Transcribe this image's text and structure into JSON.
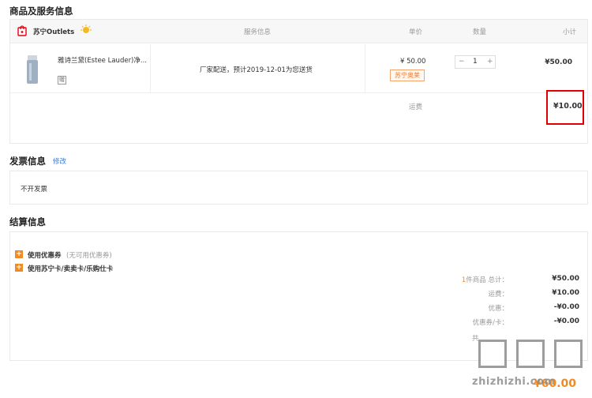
{
  "goods_section": {
    "title": "商品及服务信息",
    "store_name": "苏宁Outlets",
    "columns": {
      "service": "服务信息",
      "price": "单价",
      "qty": "数量",
      "subtotal": "小计"
    },
    "item": {
      "name": "雅诗兰黛(Estee Lauder)净...",
      "tag": "赠",
      "service_text": "厂家配送，预计2019-12-01为您送货",
      "unit_price": "¥ 50.00",
      "badge": "苏宁奥莱",
      "qty": "1",
      "minus": "−",
      "plus": "+",
      "subtotal": "¥50.00"
    },
    "shipping_label": "运费",
    "shipping_value": "¥10.00"
  },
  "invoice_section": {
    "title": "发票信息",
    "edit": "修改",
    "text": "不开发票"
  },
  "settlement_section": {
    "title": "结算信息",
    "coupon_label": "使用优惠券",
    "coupon_note": "(无可用优惠券)",
    "card_label": "使用苏宁卡/卖卖卡/乐购仕卡",
    "summary": {
      "goods_count": "1",
      "goods_label": "件商品 总计：",
      "goods_total": "¥50.00",
      "shipping_label": "运费：",
      "shipping": "¥10.00",
      "discount_label": "优惠：",
      "discount": "-¥0.00",
      "coupon_card_label": "优惠券/卡：",
      "coupon_card": "-¥0.00"
    },
    "partial_text": "共",
    "total": "¥60.00"
  },
  "watermark": {
    "text": "zhizhizhi.com"
  }
}
